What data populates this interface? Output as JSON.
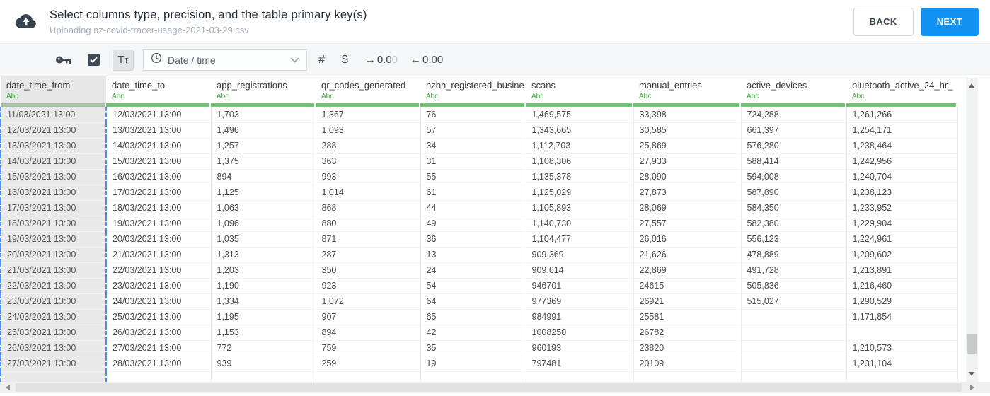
{
  "header": {
    "title": "Select columns type, precision, and the table primary key(s)",
    "subtitle": "Uploading nz-covid-tracer-usage-2021-03-29.csv",
    "back_label": "BACK",
    "next_label": "NEXT"
  },
  "toolbar": {
    "key_icon": "primary-key-icon",
    "checkbox_checked": true,
    "text_type_label_big": "T",
    "text_type_label_small": "T",
    "type_select": {
      "icon": "clock-icon",
      "value": "Date / time"
    },
    "number_symbol": "#",
    "currency_symbol": "$",
    "precision_increase": {
      "arrow": "→",
      "value_main": "0.0",
      "value_faded": "0"
    },
    "precision_decrease": {
      "arrow": "←",
      "value": "0.00"
    }
  },
  "table": {
    "columns": [
      {
        "name": "date_time_from",
        "type": "Abc",
        "selected": true
      },
      {
        "name": "date_time_to",
        "type": "Abc",
        "selected": false
      },
      {
        "name": "app_registrations",
        "type": "Abc",
        "selected": false
      },
      {
        "name": "qr_codes_generated",
        "type": "Abc",
        "selected": false
      },
      {
        "name": "nzbn_registered_busine",
        "type": "Abc",
        "selected": false
      },
      {
        "name": "scans",
        "type": "Abc",
        "selected": false
      },
      {
        "name": "manual_entries",
        "type": "Abc",
        "selected": false
      },
      {
        "name": "active_devices",
        "type": "Abc",
        "selected": false
      },
      {
        "name": "bluetooth_active_24_hr_",
        "type": "Abc",
        "selected": false
      }
    ],
    "rows": [
      [
        "11/03/2021 13:00",
        "12/03/2021 13:00",
        "1,703",
        "1,367",
        "76",
        "1,469,575",
        "33,398",
        "724,288",
        "1,261,266"
      ],
      [
        "12/03/2021 13:00",
        "13/03/2021 13:00",
        "1,496",
        "1,093",
        "57",
        "1,343,665",
        "30,585",
        "661,397",
        "1,254,171"
      ],
      [
        "13/03/2021 13:00",
        "14/03/2021 13:00",
        "1,257",
        "288",
        "34",
        "1,112,703",
        "25,869",
        "576,280",
        "1,238,464"
      ],
      [
        "14/03/2021 13:00",
        "15/03/2021 13:00",
        "1,375",
        "363",
        "31",
        "1,108,306",
        "27,933",
        "588,414",
        "1,242,956"
      ],
      [
        "15/03/2021 13:00",
        "16/03/2021 13:00",
        "894",
        "993",
        "55",
        "1,135,378",
        "28,090",
        "594,008",
        "1,240,704"
      ],
      [
        "16/03/2021 13:00",
        "17/03/2021 13:00",
        "1,125",
        "1,014",
        "61",
        "1,125,029",
        "27,873",
        "587,890",
        "1,238,123"
      ],
      [
        "17/03/2021 13:00",
        "18/03/2021 13:00",
        "1,063",
        "868",
        "44",
        "1,105,893",
        "28,069",
        "584,350",
        "1,233,952"
      ],
      [
        "18/03/2021 13:00",
        "19/03/2021 13:00",
        "1,096",
        "880",
        "49",
        "1,140,730",
        "27,557",
        "582,380",
        "1,229,904"
      ],
      [
        "19/03/2021 13:00",
        "20/03/2021 13:00",
        "1,035",
        "871",
        "36",
        "1,104,477",
        "26,016",
        "556,123",
        "1,224,961"
      ],
      [
        "20/03/2021 13:00",
        "21/03/2021 13:00",
        "1,313",
        "287",
        "13",
        "909,369",
        "21,626",
        "478,889",
        "1,209,602"
      ],
      [
        "21/03/2021 13:00",
        "22/03/2021 13:00",
        "1,203",
        "350",
        "24",
        "909,614",
        "22,869",
        "491,728",
        "1,213,891"
      ],
      [
        "22/03/2021 13:00",
        "23/03/2021 13:00",
        "1,190",
        "923",
        "54",
        "946701",
        "24615",
        "505,836",
        "1,216,460"
      ],
      [
        "23/03/2021 13:00",
        "24/03/2021 13:00",
        "1,334",
        "1,072",
        "64",
        "977369",
        "26921",
        "515,027",
        "1,290,529"
      ],
      [
        "24/03/2021 13:00",
        "25/03/2021 13:00",
        "1,195",
        "907",
        "65",
        "984991",
        "25581",
        "",
        "1,171,854"
      ],
      [
        "25/03/2021 13:00",
        "26/03/2021 13:00",
        "1,153",
        "894",
        "42",
        "1008250",
        "26782",
        "",
        ""
      ],
      [
        "26/03/2021 13:00",
        "27/03/2021 13:00",
        "772",
        "759",
        "35",
        "960193",
        "23820",
        "",
        "1,210,573"
      ],
      [
        "27/03/2021 13:00",
        "28/03/2021 13:00",
        "939",
        "259",
        "19",
        "797481",
        "20109",
        "",
        "1,231,104"
      ]
    ]
  },
  "colors": {
    "accent_blue": "#1191f1",
    "type_green": "#3aa53a",
    "header_underline_green": "#72c374",
    "selection_dash_blue": "#4b8cf5"
  }
}
